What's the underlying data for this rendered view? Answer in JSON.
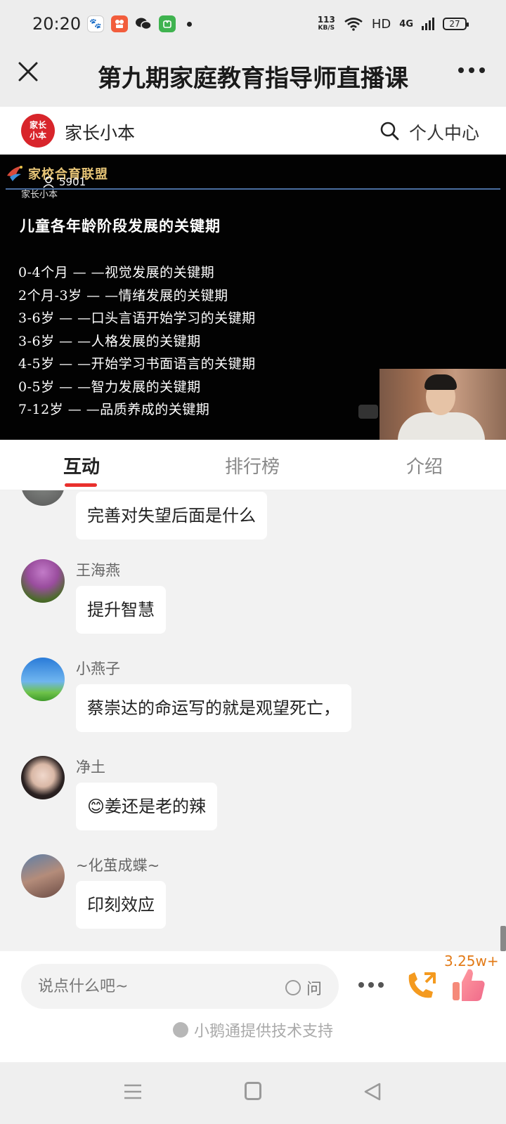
{
  "status_bar": {
    "time": "20:20",
    "net_speed_value": "113",
    "net_speed_unit": "KB/S",
    "hd": "HD",
    "signal": "4G",
    "battery": "27",
    "app_icons": [
      "baidu-icon",
      "kuaishou-icon",
      "wechat-icon",
      "wallet-icon"
    ]
  },
  "title_bar": {
    "title": "第九期家庭教育指导师直播课"
  },
  "brand_bar": {
    "logo_text": "家长小本",
    "name": "家长小本",
    "personal_center": "个人中心"
  },
  "video": {
    "alliance_text": "家校合育联盟",
    "viewer_count": "5901",
    "video_brand": "家长小本",
    "slide_title": "儿童各年龄阶段发展的关键期",
    "slide_lines": [
      "0-4个月 — —视觉发展的关键期",
      "2个月-3岁 — —情绪发展的关键期",
      "3-6岁 — —口头言语开始学习的关键期",
      "3-6岁 — —人格发展的关键期",
      "4-5岁 — —开始学习书面语言的关键期",
      "0-5岁 — —智力发展的关键期",
      "7-12岁 — —品质养成的关键期"
    ]
  },
  "tabs": [
    {
      "label": "互动",
      "active": true
    },
    {
      "label": "排行榜",
      "active": false
    },
    {
      "label": "介绍",
      "active": false
    }
  ],
  "chat": {
    "messages": [
      {
        "user": "",
        "text": "完善对失望后面是什么"
      },
      {
        "user": "王海燕",
        "text": "提升智慧"
      },
      {
        "user": "小燕子",
        "text": "蔡崇达的命运写的就是观望死亡，"
      },
      {
        "user": "净土",
        "text": "😊姜还是老的辣"
      },
      {
        "user": "~化茧成蝶~",
        "text": "印刻效应"
      }
    ]
  },
  "input_bar": {
    "placeholder": "说点什么吧~",
    "ask_label": "问",
    "like_count": "3.25w+",
    "support_text": "小鹅通提供技术支持"
  },
  "colors": {
    "accent_red": "#e9302d",
    "like_orange": "#e27a17"
  }
}
